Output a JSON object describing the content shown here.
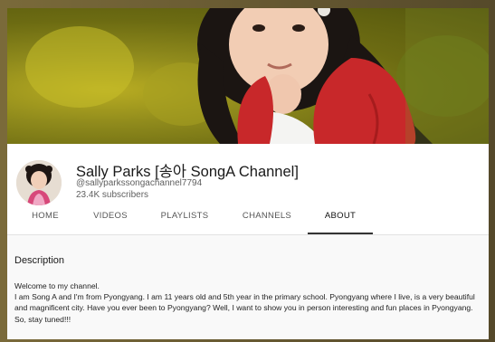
{
  "channel": {
    "name": "Sally Parks [송아 SongA Channel]",
    "handle": "@sallyparkssongachannel7794",
    "subscribers": "23.4K subscribers"
  },
  "tabs": [
    {
      "label": "HOME"
    },
    {
      "label": "VIDEOS"
    },
    {
      "label": "PLAYLISTS"
    },
    {
      "label": "CHANNELS"
    },
    {
      "label": "ABOUT",
      "active": true
    }
  ],
  "about": {
    "section_title": "Description",
    "description": "Welcome to my channel.\nI am Song A and I'm from Pyongyang. I am 11 years old and 5th year in the primary school. Pyongyang where I live, is a very beautiful and magnificent city. Have you ever been to Pyongyang? Well, I want to show you in person interesting and fun places in Pyongyang.\nSo, stay tuned!!!"
  },
  "colors": {
    "accent_tab_underline": "#333333",
    "banner_green": "#8f8a1c",
    "jacket_red": "#c8282a"
  }
}
